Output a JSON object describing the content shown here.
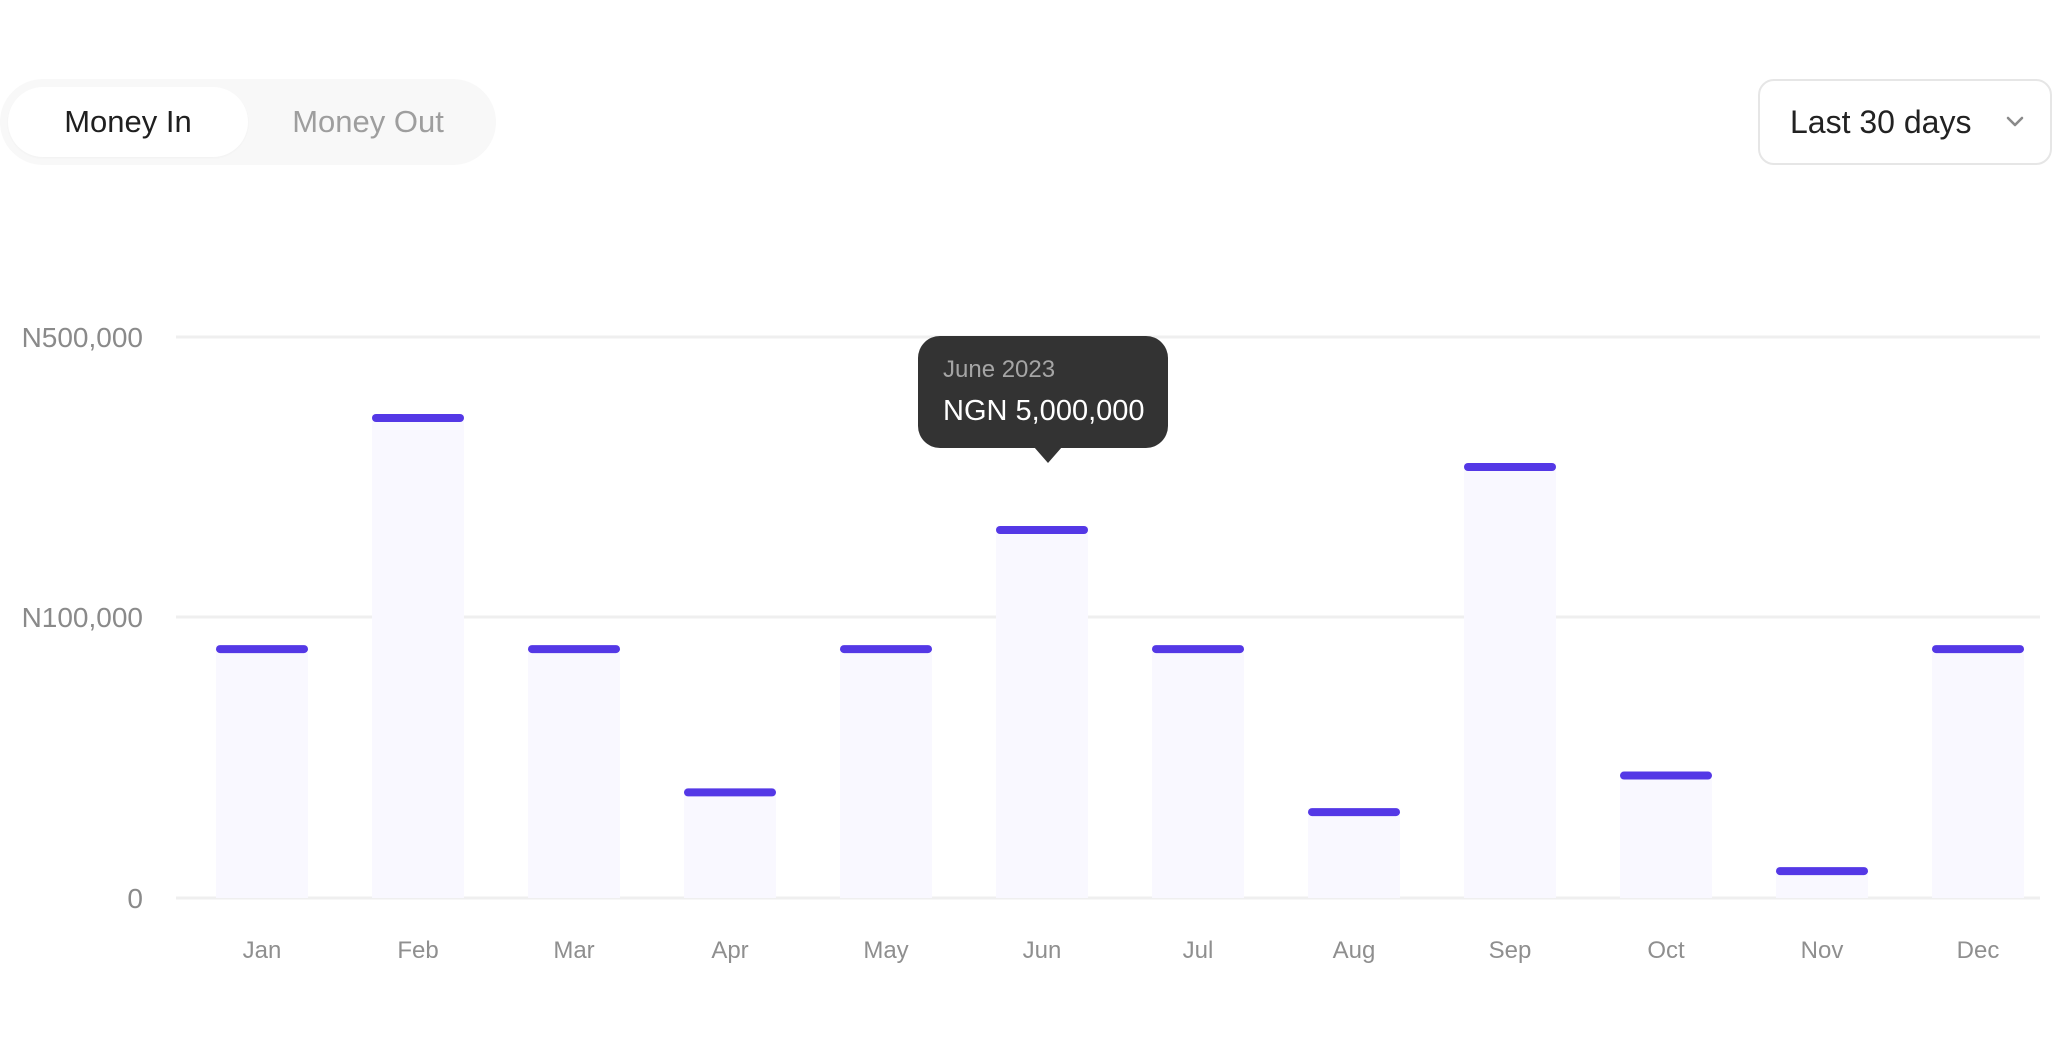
{
  "toggle": {
    "options": [
      "Money In",
      "Money Out"
    ],
    "selected": "Money In"
  },
  "period_select": {
    "value": "Last 30 days",
    "icon": "chevron-down-icon"
  },
  "tooltip": {
    "date": "June 2023",
    "value": "NGN 5,000,000"
  },
  "colors": {
    "accent": "#5438E6",
    "bar_fill": "#F9F8FF",
    "grid": "#EFEFEF",
    "tooltip_bg": "#333333"
  },
  "chart_data": {
    "type": "bar",
    "categories": [
      "Jan",
      "Feb",
      "Mar",
      "Apr",
      "May",
      "Jun",
      "Jul",
      "Aug",
      "Sep",
      "Oct",
      "Nov",
      "Dec"
    ],
    "values": [
      90000,
      390000,
      90000,
      39000,
      90000,
      230000,
      90000,
      32000,
      320000,
      45000,
      11000,
      90000
    ],
    "y_ticks": [
      {
        "label": "N500,000",
        "value": 500000
      },
      {
        "label": "N100,000",
        "value": 100000
      },
      {
        "label": "0",
        "value": 0
      }
    ],
    "highlighted": "Jun",
    "grid": true,
    "legend": "none"
  }
}
